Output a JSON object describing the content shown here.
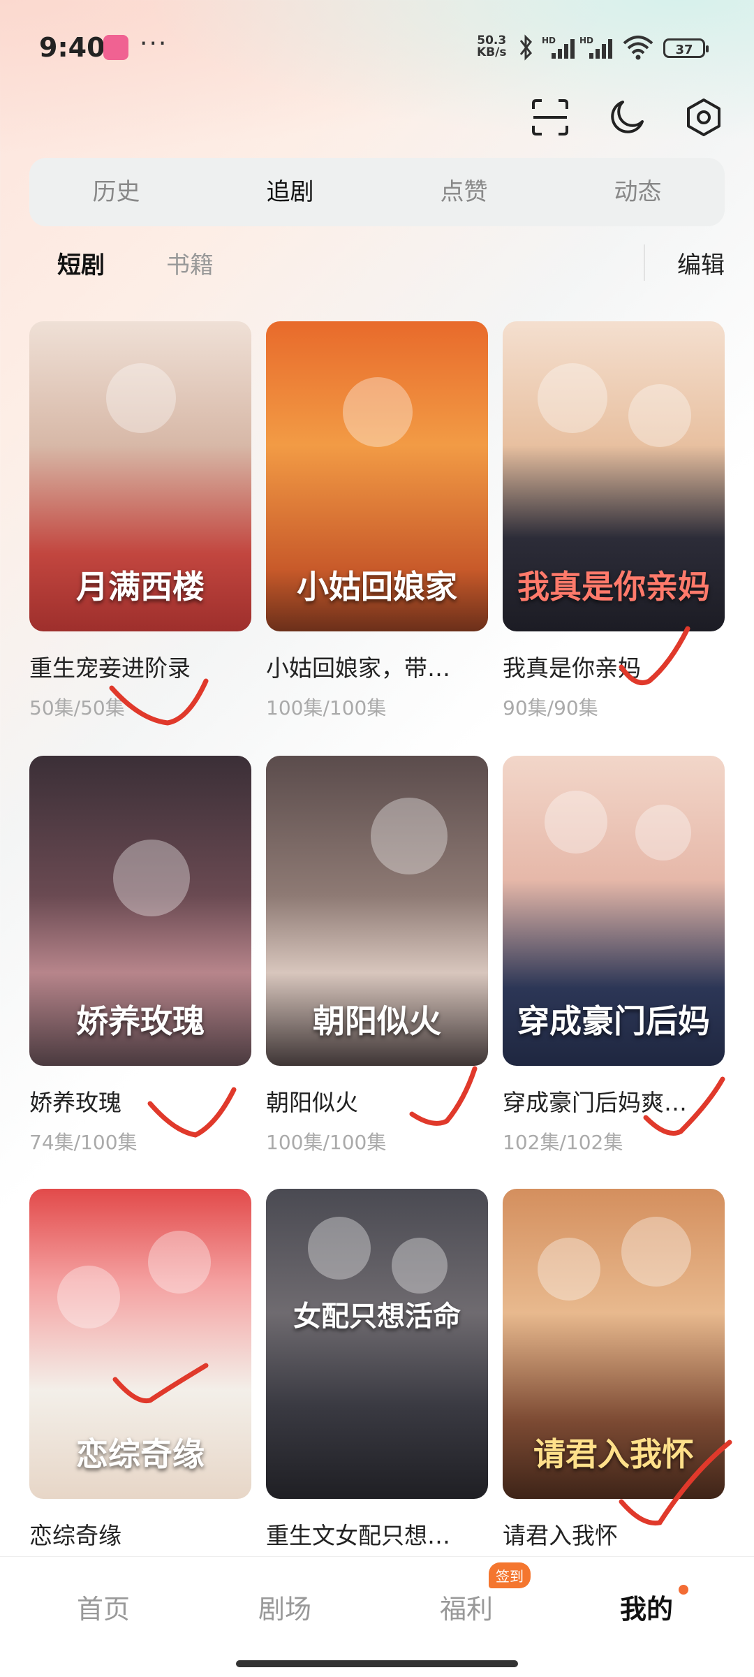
{
  "status_bar": {
    "time": "9:40",
    "net_speed_value": "50.3",
    "net_speed_unit": "KB/s",
    "signal1_label": "HD",
    "signal2_label": "HD",
    "battery": "37",
    "icons": [
      "app-badge-icon",
      "more-dots-icon",
      "bluetooth-icon",
      "signal-icon",
      "wifi-icon",
      "battery-icon"
    ]
  },
  "top_actions": [
    "scan-icon",
    "moon-icon",
    "settings-icon"
  ],
  "tabs": [
    {
      "label": "历史"
    },
    {
      "label": "追剧",
      "active": true
    },
    {
      "label": "点赞"
    },
    {
      "label": "动态"
    }
  ],
  "subtabs": {
    "short": "短剧",
    "books": "书籍",
    "edit": "编辑"
  },
  "cards": [
    {
      "title": "重生宠妾进阶录",
      "episodes": "50集/50集",
      "poster_text": "月满西楼"
    },
    {
      "title": "小姑回娘家，带…",
      "episodes": "100集/100集",
      "poster_text": "小姑回娘家"
    },
    {
      "title": "我真是你亲妈",
      "episodes": "90集/90集",
      "poster_text": "我真是你亲妈"
    },
    {
      "title": "娇养玫瑰",
      "episodes": "74集/100集",
      "poster_text": "娇养玫瑰"
    },
    {
      "title": "朝阳似火",
      "episodes": "100集/100集",
      "poster_text": "朝阳似火"
    },
    {
      "title": "穿成豪门后妈爽…",
      "episodes": "102集/102集",
      "poster_text": "穿成豪门后妈"
    },
    {
      "title": "恋综奇缘",
      "episodes": "",
      "poster_text": "恋综奇缘"
    },
    {
      "title": "重生文女配只想…",
      "episodes": "",
      "poster_text": "女配只想活命"
    },
    {
      "title": "请君入我怀",
      "episodes": "",
      "poster_text": "请君入我怀"
    }
  ],
  "bottom_nav": {
    "home": "首页",
    "theater": "剧场",
    "welfare": "福利",
    "signin_badge": "签到",
    "mine": "我的"
  },
  "colors": {
    "accent_orange": "#f4762f",
    "check_red": "#e0392b"
  }
}
